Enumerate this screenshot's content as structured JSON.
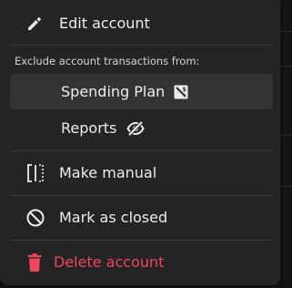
{
  "menu": {
    "edit": {
      "label": "Edit account",
      "icon": "pencil-icon"
    },
    "exclude_heading": "Exclude account transactions from:",
    "exclude_items": [
      {
        "label": "Spending Plan",
        "icon": "no-budget-icon",
        "active": true
      },
      {
        "label": "Reports",
        "icon": "eye-off-icon",
        "active": false
      }
    ],
    "make_manual": {
      "label": "Make manual",
      "icon": "manual-toggle-icon"
    },
    "mark_closed": {
      "label": "Mark as closed",
      "icon": "prohibited-circle-icon"
    },
    "delete": {
      "label": "Delete account",
      "icon": "trash-icon"
    }
  },
  "colors": {
    "menu_bg": "#242424",
    "active_row_bg": "#333333",
    "danger": "#f0455f",
    "text": "#ededed"
  }
}
